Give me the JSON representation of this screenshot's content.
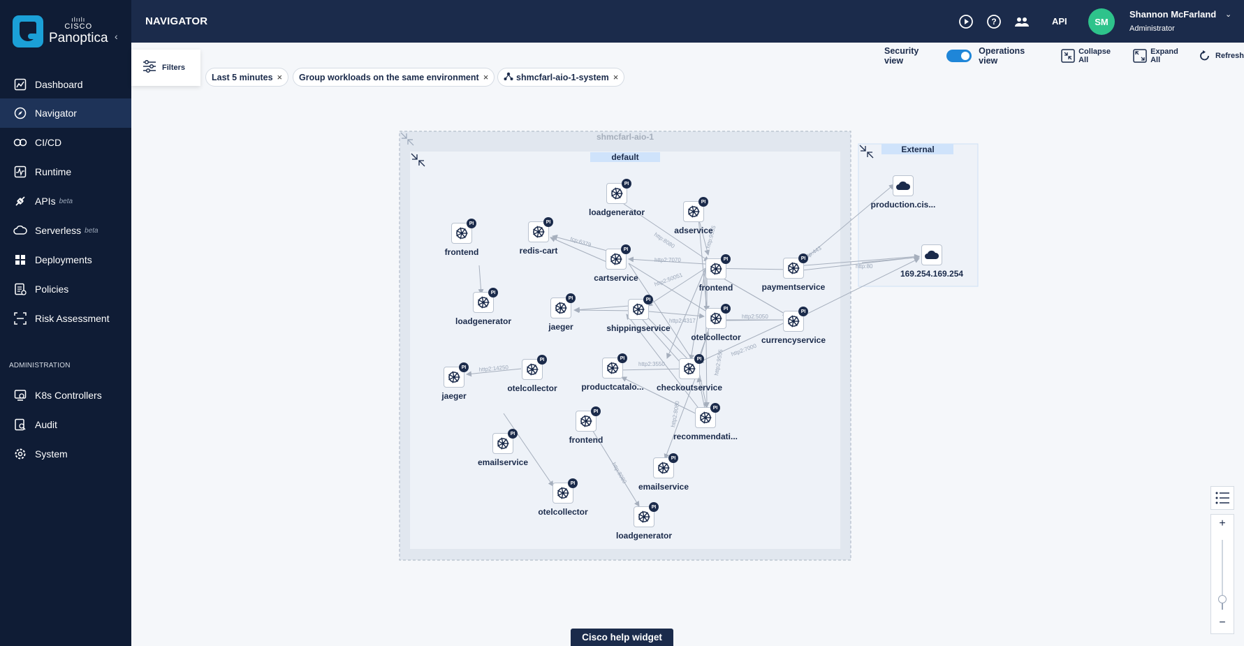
{
  "app": {
    "brand_bars": "ılıılı",
    "brand_cisco": "CISCO",
    "brand_name": "Panoptica",
    "collapse_glyph": "‹"
  },
  "sidebar": {
    "items": [
      {
        "label": "Dashboard",
        "icon": "dashboard-icon"
      },
      {
        "label": "Navigator",
        "icon": "compass-icon",
        "active": true
      },
      {
        "label": "CI/CD",
        "icon": "cicd-loop-icon"
      },
      {
        "label": "Runtime",
        "icon": "runtime-chart-icon"
      },
      {
        "label": "APIs",
        "badge": "beta",
        "icon": "api-plug-icon"
      },
      {
        "label": "Serverless",
        "badge": "beta",
        "icon": "cloud-icon"
      },
      {
        "label": "Deployments",
        "icon": "grid-icon"
      },
      {
        "label": "Policies",
        "icon": "policy-doc-icon"
      },
      {
        "label": "Risk Assessment",
        "icon": "risk-scan-icon"
      }
    ],
    "admin_header": "ADMINISTRATION",
    "admin_items": [
      {
        "label": "K8s Controllers",
        "icon": "k8s-controller-icon"
      },
      {
        "label": "Audit",
        "icon": "audit-icon"
      },
      {
        "label": "System",
        "icon": "gear-icon"
      }
    ]
  },
  "header": {
    "title": "NAVIGATOR",
    "api_label": "API",
    "user": {
      "initials": "SM",
      "name": "Shannon McFarland",
      "role": "Administrator",
      "caret": "⌄"
    },
    "avatar_color": "#2ec38b"
  },
  "filters": {
    "button_label": "Filters",
    "chips": [
      {
        "label": "Last 5 minutes"
      },
      {
        "label": "Group workloads on the same environment"
      },
      {
        "label": "shmcfarl-aio-1-system"
      }
    ],
    "chip_close": "×"
  },
  "view_controls": {
    "security_view": "Security view",
    "operations_view": "Operations view",
    "operations_selected": true,
    "collapse_all": "Collapse All",
    "expand_all": "Expand All",
    "refresh": "Refresh"
  },
  "graph": {
    "cluster_label": "shmcfarl-aio-1",
    "namespace_label": "default",
    "external_label": "External",
    "pi_badge": "PI",
    "nodes": [
      {
        "id": "lg1",
        "label": "loadgenerator"
      },
      {
        "id": "ad",
        "label": "adservice"
      },
      {
        "id": "fe1",
        "label": "frontend"
      },
      {
        "id": "redis",
        "label": "redis-cart"
      },
      {
        "id": "cart",
        "label": "cartservice"
      },
      {
        "id": "fe2",
        "label": "frontend"
      },
      {
        "id": "pay",
        "label": "paymentservice"
      },
      {
        "id": "lg2",
        "label": "loadgenerator"
      },
      {
        "id": "jg1",
        "label": "jaeger"
      },
      {
        "id": "ship",
        "label": "shippingservice"
      },
      {
        "id": "otel1",
        "label": "otelcollector"
      },
      {
        "id": "curr",
        "label": "currencyservice"
      },
      {
        "id": "jg2",
        "label": "jaeger"
      },
      {
        "id": "otel2",
        "label": "otelcollector"
      },
      {
        "id": "prod",
        "label": "productcatalo..."
      },
      {
        "id": "co",
        "label": "checkoutservice"
      },
      {
        "id": "fe3",
        "label": "frontend"
      },
      {
        "id": "rec",
        "label": "recommendati..."
      },
      {
        "id": "email1",
        "label": "emailservice"
      },
      {
        "id": "email2",
        "label": "emailservice"
      },
      {
        "id": "otel3",
        "label": "otelcollector"
      },
      {
        "id": "lg3",
        "label": "loadgenerator"
      }
    ],
    "external_nodes": [
      {
        "id": "ext1",
        "label": "production.cis..."
      },
      {
        "id": "ext2",
        "label": "169.254.169.254"
      }
    ],
    "edge_labels": [
      "tcp:6379",
      "http:8080",
      "http2:7070",
      "http2:50051",
      "http:9555",
      "http2:4317",
      "http2:3550",
      "http2:14250",
      "http2:7000",
      "http:80",
      "http:443",
      "http2:5050",
      "http2:9555",
      "http:8080",
      "http2:8080"
    ]
  },
  "zoom": {
    "in": "+",
    "out": "−",
    "level": 0.15
  },
  "help_widget": "Cisco help widget",
  "colors": {
    "sidebar": "#0f1c35",
    "header": "#1b2b4b",
    "accent": "#1f86d8",
    "active_nav": "#1e3358"
  }
}
